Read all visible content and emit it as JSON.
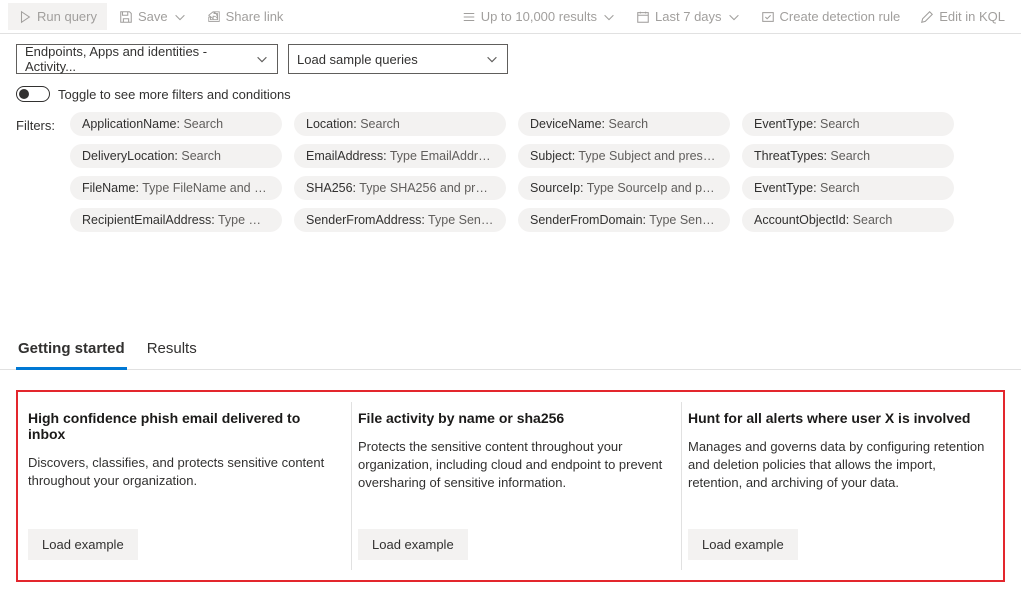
{
  "toolbar": {
    "run": "Run query",
    "save": "Save",
    "share": "Share link",
    "results_limit": "Up to 10,000 results",
    "time_range": "Last 7 days",
    "create_rule": "Create detection rule",
    "edit_kql": "Edit in KQL"
  },
  "dropdowns": {
    "scope": "Endpoints, Apps and identities - Activity...",
    "sample": "Load sample queries"
  },
  "toggle_label": "Toggle to see more filters and conditions",
  "filters_label": "Filters:",
  "filters": [
    {
      "key": "ApplicationName",
      "value": "Search"
    },
    {
      "key": "Location",
      "value": "Search"
    },
    {
      "key": "DeviceName",
      "value": "Search"
    },
    {
      "key": "EventType",
      "value": "Search"
    },
    {
      "key": "DeliveryLocation",
      "value": "Search"
    },
    {
      "key": "EmailAddress",
      "value": "Type EmailAddres..."
    },
    {
      "key": "Subject",
      "value": "Type Subject and press ..."
    },
    {
      "key": "ThreatTypes",
      "value": "Search"
    },
    {
      "key": "FileName",
      "value": "Type FileName and pr..."
    },
    {
      "key": "SHA256",
      "value": "Type SHA256 and pres..."
    },
    {
      "key": "SourceIp",
      "value": "Type SourceIp and pre..."
    },
    {
      "key": "EventType",
      "value": "Search"
    },
    {
      "key": "RecipientEmailAddress",
      "value": "Type Rec..."
    },
    {
      "key": "SenderFromAddress",
      "value": "Type Send..."
    },
    {
      "key": "SenderFromDomain",
      "value": "Type Sende..."
    },
    {
      "key": "AccountObjectId",
      "value": "Search"
    }
  ],
  "tabs": {
    "getting_started": "Getting started",
    "results": "Results"
  },
  "cards": [
    {
      "title": "High confidence phish email delivered to inbox",
      "desc": "Discovers, classifies, and protects sensitive content throughout your organization.",
      "btn": "Load example"
    },
    {
      "title": "File activity by name or sha256",
      "desc": "Protects the sensitive content throughout your organization, including cloud and endpoint to prevent oversharing of sensitive information.",
      "btn": "Load example"
    },
    {
      "title": "Hunt for all alerts where user X is involved",
      "desc": "Manages and governs data by configuring retention and deletion policies that allows the import, retention, and archiving of your data.",
      "btn": "Load example"
    }
  ]
}
